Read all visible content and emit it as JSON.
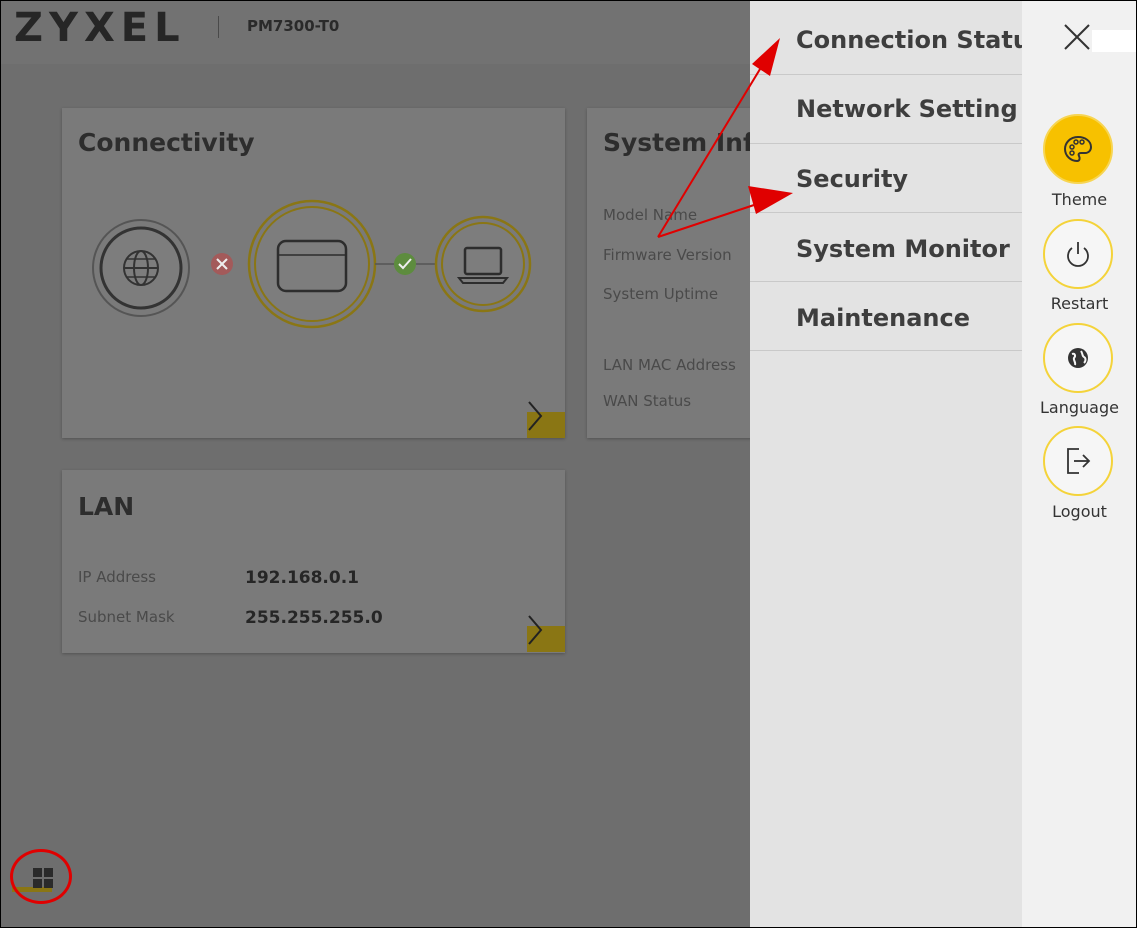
{
  "header": {
    "logo": "ZYXEL",
    "model": "PM7300-T0"
  },
  "connectivity": {
    "title": "Connectivity"
  },
  "system_info": {
    "title": "System Info",
    "labels": [
      "Model Name",
      "Firmware Version",
      "System Uptime",
      "LAN MAC Address",
      "WAN Status"
    ]
  },
  "lan": {
    "title": "LAN",
    "ip_label": "IP Address",
    "ip_value": "192.168.0.1",
    "mask_label": "Subnet Mask",
    "mask_value": "255.255.255.0"
  },
  "menu": {
    "items": [
      {
        "label": "Connection Status"
      },
      {
        "label": "Network Setting"
      },
      {
        "label": "Security"
      },
      {
        "label": "System Monitor"
      },
      {
        "label": "Maintenance"
      }
    ]
  },
  "side": {
    "theme": "Theme",
    "restart": "Restart",
    "language": "Language",
    "logout": "Logout"
  },
  "colors": {
    "accent": "#f7c100",
    "annotation": "#e00000"
  }
}
